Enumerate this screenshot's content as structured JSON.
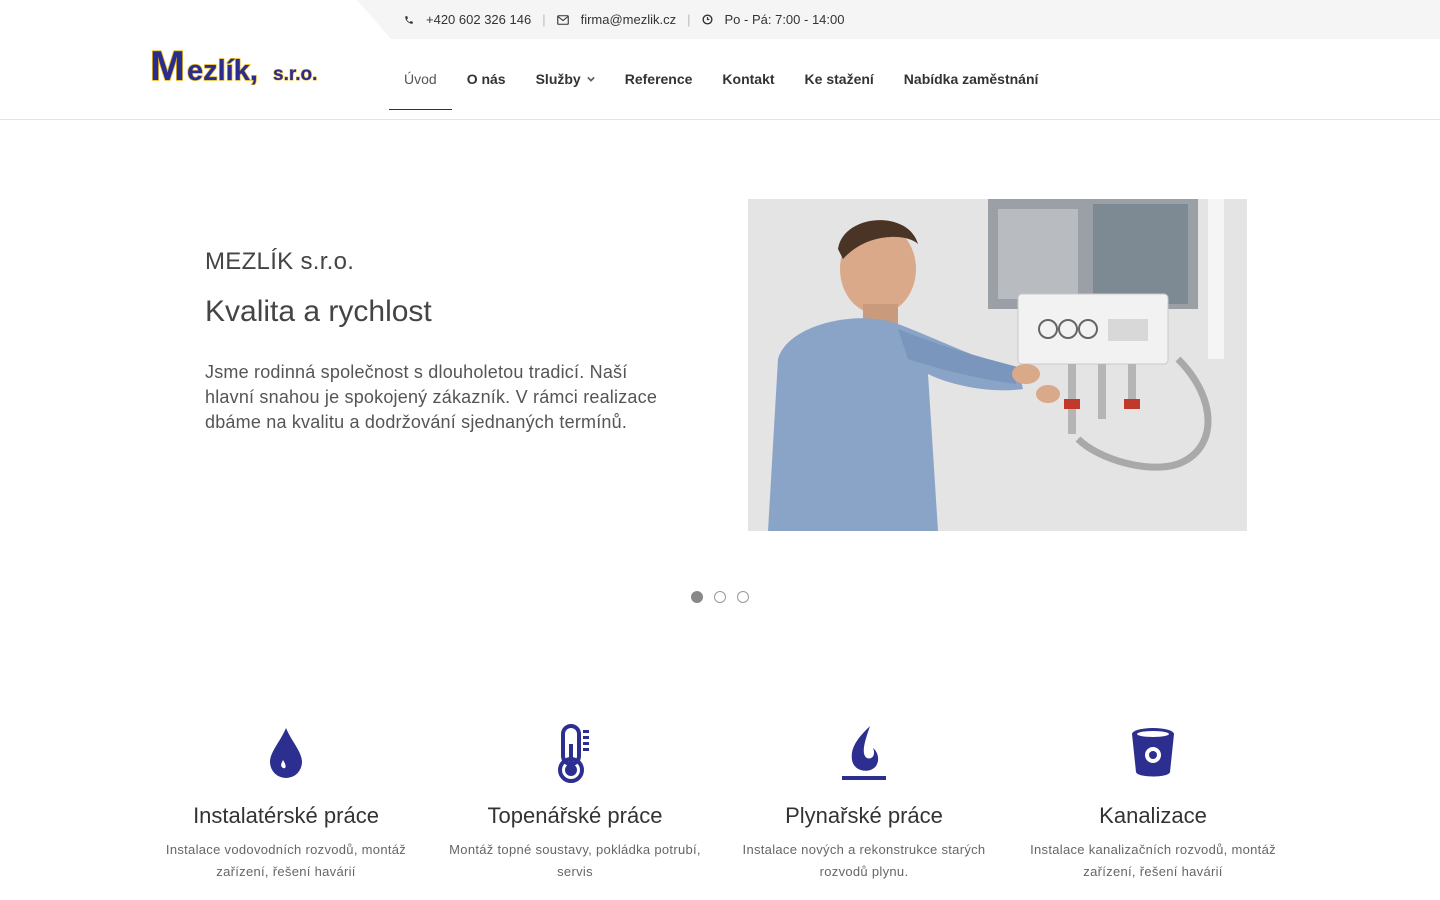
{
  "topbar": {
    "phone": "+420 602 326 146",
    "email": "firma@mezlik.cz",
    "hours": "Po - Pá: 7:00 - 14:00",
    "separator": "|",
    "icons": [
      "phone-icon",
      "envelope-icon",
      "clock-icon"
    ]
  },
  "logo": {
    "text": "Mezlík, s.r.o.",
    "colors": {
      "fill": "#2a2d8f",
      "outline": "#e8b61a"
    }
  },
  "nav": {
    "items": [
      {
        "label": "Úvod",
        "active": true
      },
      {
        "label": "O nás"
      },
      {
        "label": "Služby",
        "has_dropdown": true
      },
      {
        "label": "Reference"
      },
      {
        "label": "Kontakt"
      },
      {
        "label": "Ke stažení"
      },
      {
        "label": "Nabídka zaměstnání"
      }
    ]
  },
  "hero": {
    "kicker": "MEZLÍK s.r.o.",
    "title": "Kvalita a rychlost",
    "text": "Jsme rodinná společnost s dlouholetou tradicí. Naší hlavní snahou je spokojený zákazník. V rámci realizace dbáme na kvalitu a dodržování sjednaných termínů.",
    "image": "plumber-repairing-boiler-photo",
    "slides_count": 3,
    "active_slide": 1
  },
  "services": [
    {
      "icon": "water-drop-icon",
      "title": "Instalatérské práce",
      "desc": "Instalace vodovodních rozvodů, montáž zařízení, řešení havárií"
    },
    {
      "icon": "thermometer-icon",
      "title": "Topenářské práce",
      "desc": "Montáž topné soustavy, pokládka potrubí, servis"
    },
    {
      "icon": "gas-flame-icon",
      "title": "Plynařské práce",
      "desc": "Instalace nových a rekonstrukce starých rozvodů plynu."
    },
    {
      "icon": "bucket-icon",
      "title": "Kanalizace",
      "desc": "Instalace kanalizačních rozvodů, montáž zařízení, řešení havárií"
    }
  ],
  "colors": {
    "accent": "#2c2f8f",
    "text": "#333333",
    "topbar_bg": "#f5f5f5"
  }
}
